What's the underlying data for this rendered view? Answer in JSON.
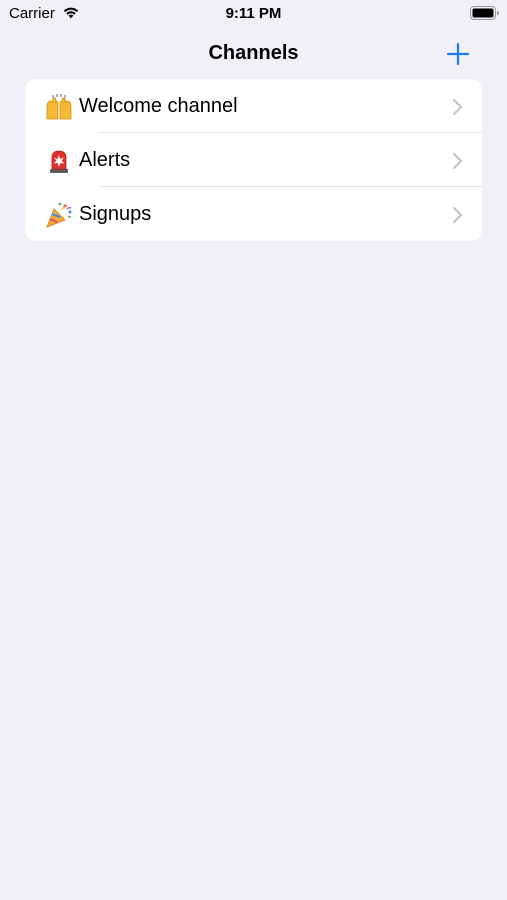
{
  "status_bar": {
    "carrier": "Carrier",
    "time": "9:11 PM",
    "wifi_icon": "wifi-icon",
    "battery_icon": "battery-full-icon"
  },
  "nav": {
    "title": "Channels",
    "add_icon": "plus-icon",
    "accent_color": "#1A7CF0"
  },
  "channels": [
    {
      "emoji_name": "raised-hands-icon",
      "label": "Welcome channel",
      "chevron": "chevron-right-icon"
    },
    {
      "emoji_name": "siren-light-icon",
      "label": "Alerts",
      "chevron": "chevron-right-icon"
    },
    {
      "emoji_name": "party-popper-icon",
      "label": "Signups",
      "chevron": "chevron-right-icon"
    }
  ],
  "colors": {
    "background": "#F1F0F6",
    "card": "#FFFFFF",
    "separator": "#E3E3E7",
    "chevron": "#C4C4C7"
  }
}
